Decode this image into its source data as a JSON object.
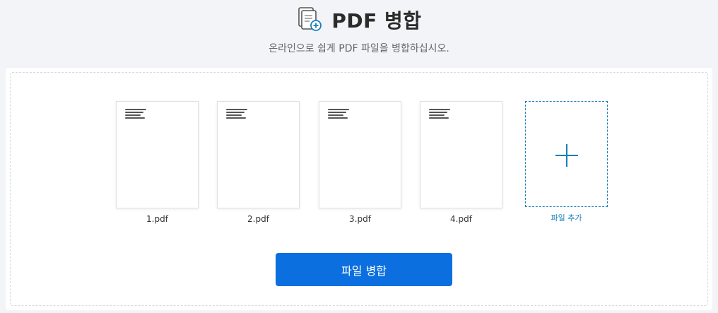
{
  "header": {
    "title": "PDF 병합",
    "subtitle": "온라인으로 쉽게 PDF 파일을 병합하십시오.",
    "icon": "pdf-merge-icon",
    "accent_color": "#1a7fb8"
  },
  "files": [
    {
      "name": "1.pdf"
    },
    {
      "name": "2.pdf"
    },
    {
      "name": "3.pdf"
    },
    {
      "name": "4.pdf"
    }
  ],
  "add_file": {
    "label": "파일 추가",
    "icon": "plus-icon"
  },
  "merge_button": {
    "label": "파일 병합",
    "color": "#0b6fe0"
  }
}
